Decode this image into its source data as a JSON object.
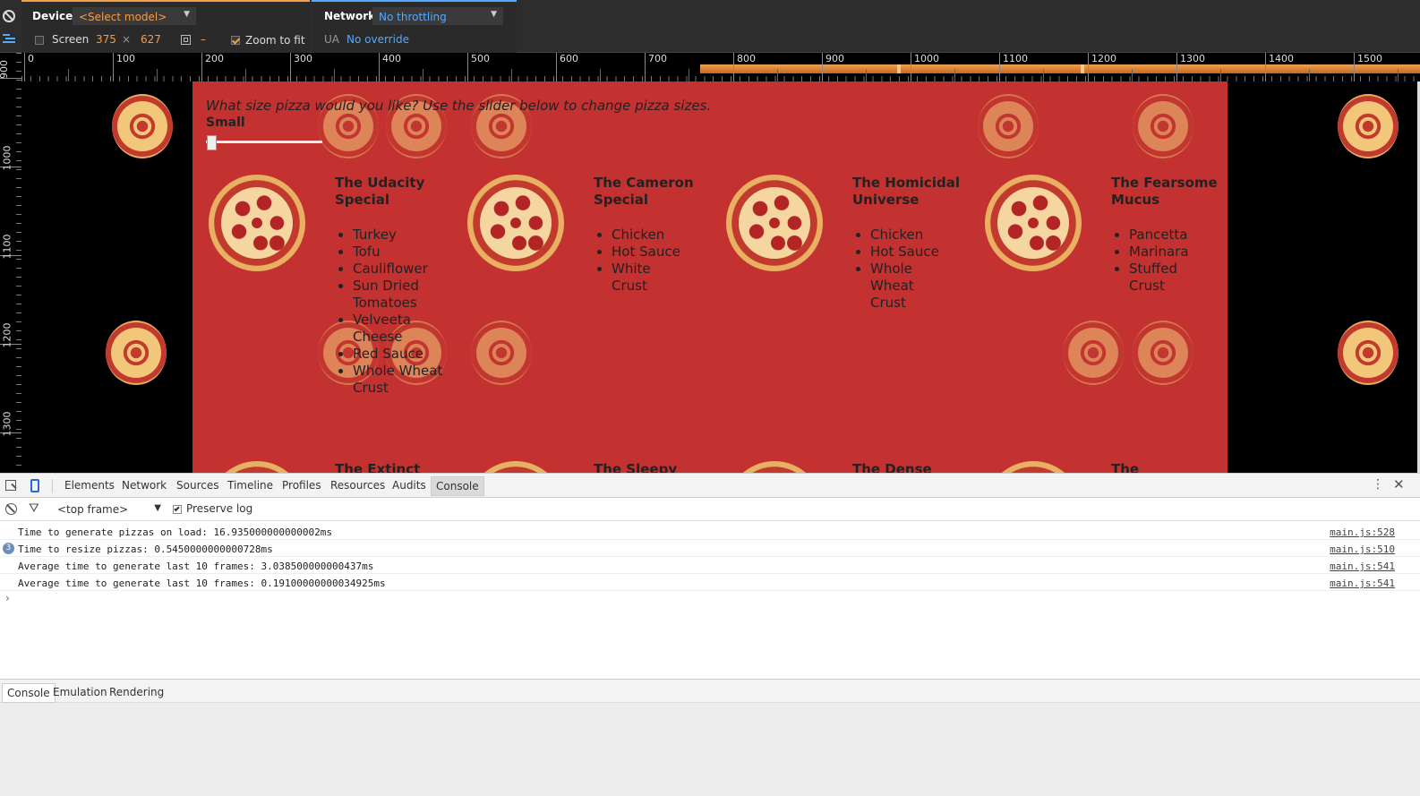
{
  "toolbar": {
    "device_label": "Device",
    "device_model": "<Select model>",
    "screen_label": "Screen",
    "screen_width": "375",
    "screen_times": "×",
    "screen_height": "627",
    "dash": "–",
    "zoom_label": "Zoom to fit",
    "network_label": "Network",
    "network_value": "No throttling",
    "ua_label": "UA",
    "ua_value": "No override"
  },
  "ruler": {
    "top_labels": [
      "0",
      "100",
      "200",
      "300",
      "400",
      "500",
      "600",
      "700",
      "800",
      "900",
      "1000",
      "1100",
      "1200",
      "1300",
      "1400",
      "1500"
    ],
    "left_labels": [
      "900",
      "1000",
      "1100",
      "1200",
      "1300"
    ]
  },
  "page": {
    "prompt": "What size pizza would you like? Use the slider below to change pizza sizes.",
    "size_label": "Small",
    "slider_value": 0,
    "pizzas": [
      {
        "title": "The Udacity Special",
        "ingredients": [
          "Turkey",
          "Tofu",
          "Cauliflower",
          "Sun Dried Tomatoes",
          "Velveeta Cheese",
          "Red Sauce",
          "Whole Wheat Crust"
        ]
      },
      {
        "title": "The Cameron Special",
        "ingredients": [
          "Chicken",
          "Hot Sauce",
          "White Crust"
        ]
      },
      {
        "title": "The Homicidal Universe",
        "ingredients": [
          "Chicken",
          "Hot Sauce",
          "Whole Wheat Crust"
        ]
      },
      {
        "title": "The Fearsome Mucus",
        "ingredients": [
          "Pancetta",
          "Marinara",
          "Stuffed Crust"
        ]
      }
    ],
    "next_row_titles": [
      "The Extinct",
      "The Sleepy",
      "The Dense",
      "The"
    ]
  },
  "devtools": {
    "tabs": [
      "Elements",
      "Network",
      "Sources",
      "Timeline",
      "Profiles",
      "Resources",
      "Audits",
      "Console"
    ],
    "selected_tab": "Console",
    "frame_select": "<top frame>",
    "preserve_log": "Preserve log",
    "console": [
      {
        "text": "Time to generate pizzas on load: 16.935000000000002ms",
        "source": "main.js:528",
        "count": ""
      },
      {
        "text": "Time to resize pizzas: 0.5450000000000728ms",
        "source": "main.js:510",
        "count": "3"
      },
      {
        "text": "Average time to generate last 10 frames: 3.038500000000437ms",
        "source": "main.js:541",
        "count": ""
      },
      {
        "text": "Average time to generate last 10 frames: 0.19100000000034925ms",
        "source": "main.js:541",
        "count": ""
      }
    ],
    "prompt_caret": "›",
    "drawer_tabs": [
      "Console",
      "Emulation",
      "Rendering"
    ]
  },
  "colors": {
    "page_bg": "#c33131",
    "devtools_accent": "#f29d4a",
    "link_blue": "#55a9ff"
  }
}
